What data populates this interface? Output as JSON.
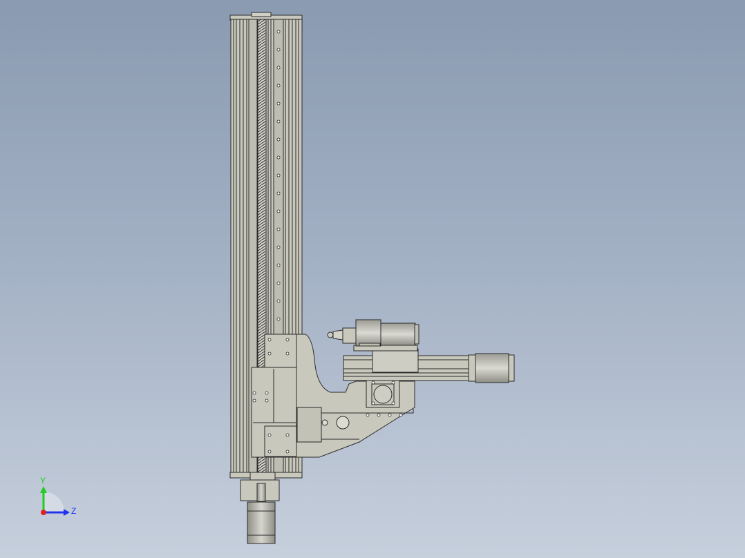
{
  "viewport": {
    "background_top": "#8a9ab0",
    "background_bottom": "#c6cfdc"
  },
  "model": {
    "part_fill": "#c8c8bc",
    "part_stroke": "#2a2a2a",
    "rail_fill": "#b9b9ad",
    "motor_fill": "#b0b0a6"
  },
  "triad": {
    "y_label": "Y",
    "z_label": "Z",
    "y_color": "#22cc22",
    "z_color": "#2233ee",
    "x_color": "#dd2222"
  }
}
